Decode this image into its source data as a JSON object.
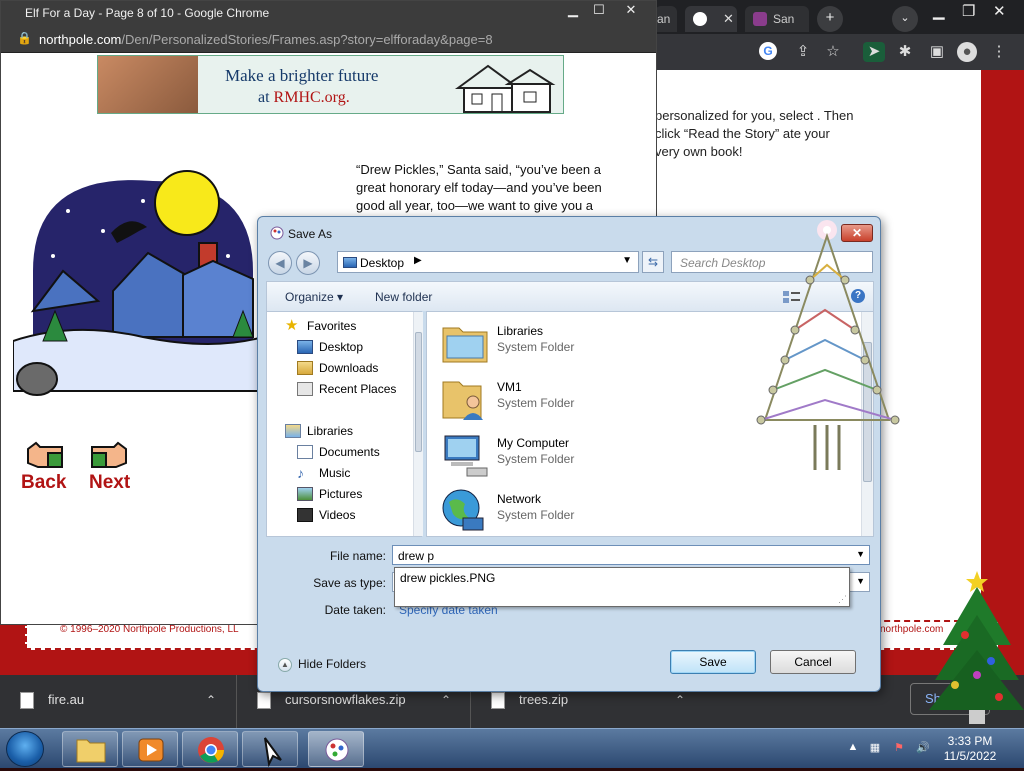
{
  "bg_browser": {
    "tabs": [
      {
        "label": "an"
      },
      {
        "label": ""
      },
      {
        "label": "San"
      }
    ],
    "new_tab": "+"
  },
  "bg_page": {
    "text": "personalized for you, select . Then click “Read the Story” ate your very own book!",
    "footer_left": "© 1996–2020 Northpole Productions, LL",
    "footer_right": "northpole.com"
  },
  "downloads": {
    "items": [
      {
        "label": "fire.au"
      },
      {
        "label": "cursorsnowflakes.zip"
      },
      {
        "label": "trees.zip"
      }
    ],
    "show_all": "Sh"
  },
  "fg_browser": {
    "title": "Elf For a Day - Page 8 of 10 - Google Chrome",
    "url_host": "northpole.com",
    "url_path": "/Den/PersonalizedStories/Frames.asp?story=elfforaday&page=8"
  },
  "banner": {
    "line1": "Make a brighter future",
    "line2_prefix": "at ",
    "line2_link": "RMHC.org."
  },
  "story": {
    "text": "“Drew Pickles,” Santa said, “you’ve been a great honorary elf today—and you’ve been good all year, too—we want to give you a"
  },
  "nav": {
    "back": "Back",
    "next": "Next"
  },
  "dialog": {
    "title": "Save As",
    "location": "Desktop",
    "search_placeholder": "Search Desktop",
    "organize": "Organize",
    "new_folder": "New folder",
    "favorites": "Favorites",
    "fav_items": [
      "Desktop",
      "Downloads",
      "Recent Places"
    ],
    "libraries": "Libraries",
    "lib_items": [
      "Documents",
      "Music",
      "Pictures",
      "Videos"
    ],
    "files": [
      {
        "name": "Libraries",
        "sub": "System Folder"
      },
      {
        "name": "VM1",
        "sub": "System Folder"
      },
      {
        "name": "My Computer",
        "sub": "System Folder"
      },
      {
        "name": "Network",
        "sub": "System Folder"
      }
    ],
    "file_name_label": "File name:",
    "file_name_value": "drew p",
    "save_type_label": "Save as type:",
    "date_taken_label": "Date taken:",
    "date_taken_link": "Specify date taken",
    "suggestion": "drew pickles.PNG",
    "hide_folders": "Hide Folders",
    "save": "Save",
    "cancel": "Cancel"
  },
  "taskbar": {
    "time": "3:33 PM",
    "date": "11/5/2022"
  },
  "colors": {
    "north_red": "#b11414",
    "dialog_frame": "#c9dbec",
    "link_blue": "#3067b8"
  }
}
